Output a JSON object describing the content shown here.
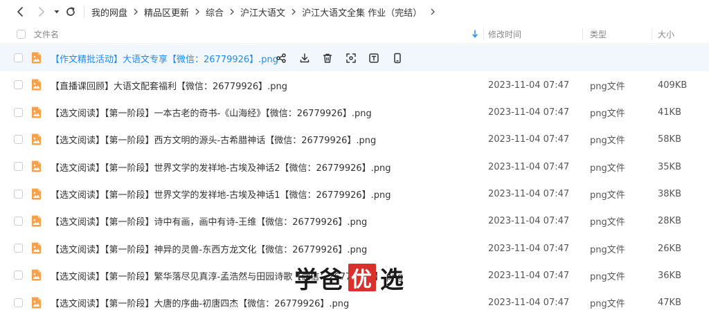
{
  "nav": {
    "back_icon": "chevron-left-icon",
    "forward_icon": "chevron-right-icon",
    "history_icon": "caret-down-icon",
    "refresh_icon": "refresh-icon"
  },
  "breadcrumb": [
    "我的网盘",
    "精品区更新",
    "综合",
    "沪江大语文",
    "沪江大语文全集 作业（完结）"
  ],
  "header": {
    "name": "文件名",
    "modified": "修改时间",
    "type": "类型",
    "size": "大小",
    "sort_icon": "sort-arrow-down-icon"
  },
  "colors": {
    "accent": "#1f8bf0",
    "hover_row": "#f2f7fe",
    "file_icon": "#f7a14a"
  },
  "hover_actions": [
    "share-icon",
    "download-icon",
    "delete-icon",
    "scan-icon",
    "text-extract-icon",
    "phone-icon"
  ],
  "files": [
    {
      "name": "【作文精批活动】大语文专享【微信：26779926】.png",
      "date": "",
      "type": "",
      "size": ""
    },
    {
      "name": "【直播课回顾】大语文配套福利【微信：26779926】.png",
      "date": "2023-11-04 07:47",
      "type": "png文件",
      "size": "409KB"
    },
    {
      "name": "【选文阅读】【第一阶段】一本古老的奇书-《山海经》【微信：26779926】.png",
      "date": "2023-11-04 07:47",
      "type": "png文件",
      "size": "41KB"
    },
    {
      "name": "【选文阅读】【第一阶段】西方文明的源头-古希腊神话【微信：26779926】.png",
      "date": "2023-11-04 07:47",
      "type": "png文件",
      "size": "58KB"
    },
    {
      "name": "【选文阅读】【第一阶段】世界文学的发祥地-古埃及神话2【微信：26779926】.png",
      "date": "2023-11-04 07:47",
      "type": "png文件",
      "size": "35KB"
    },
    {
      "name": "【选文阅读】【第一阶段】世界文学的发祥地-古埃及神话1【微信：26779926】.png",
      "date": "2023-11-04 07:47",
      "type": "png文件",
      "size": "38KB"
    },
    {
      "name": "【选文阅读】【第一阶段】诗中有画，画中有诗-王维【微信：26779926】.png",
      "date": "2023-11-04 07:47",
      "type": "png文件",
      "size": "28KB"
    },
    {
      "name": "【选文阅读】【第一阶段】神异的灵兽-东西方龙文化【微信：26779926】.png",
      "date": "2023-11-04 07:47",
      "type": "png文件",
      "size": "26KB"
    },
    {
      "name": "【选文阅读】【第一阶段】繁华落尽见真淳-孟浩然与田园诗歌【微信：26779926】.png",
      "date": "2023-11-04 07:47",
      "type": "png文件",
      "size": "36KB"
    },
    {
      "name": "【选文阅读】【第一阶段】大唐的序曲-初唐四杰【微信：26779926】.png",
      "date": "2023-11-04 07:47",
      "type": "png文件",
      "size": "47KB"
    }
  ],
  "watermark": {
    "part1": "学爸",
    "part2": "优",
    "part3": "选"
  }
}
